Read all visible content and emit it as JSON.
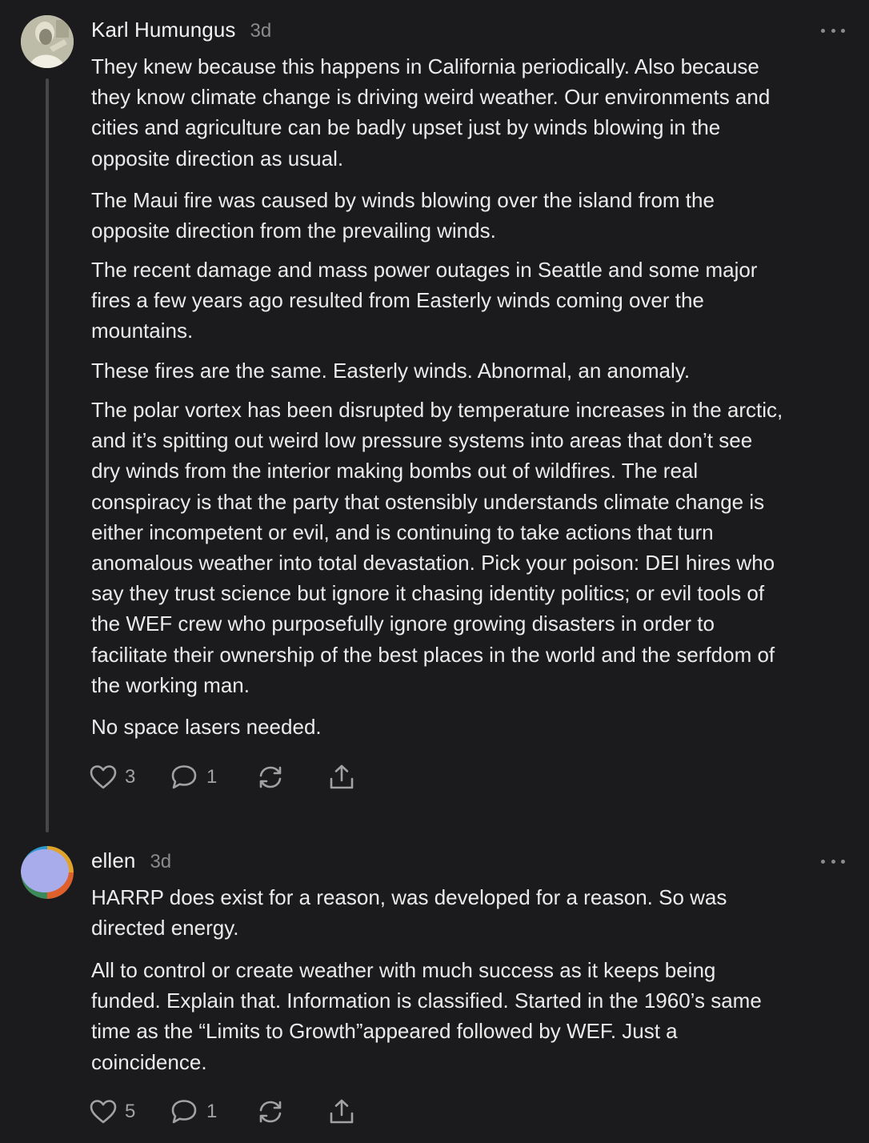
{
  "comments": [
    {
      "author": "Karl Humungus",
      "age": "3d",
      "paragraphs": [
        "They knew because this happens in California periodically. Also because\nthey know climate change is driving weird weather. Our environments and\ncities and agriculture can be badly upset just by winds blowing in the\nopposite direction as usual.",
        "The Maui fire was caused by winds blowing over the island from the\nopposite direction from the prevailing winds.",
        "The recent damage and mass power outages in Seattle and some major\nfires a few years ago resulted from Easterly winds coming over the\nmountains.",
        "These fires are the same. Easterly winds. Abnormal, an anomaly.",
        "The polar vortex has been disrupted by temperature increases in the arctic,\nand it’s spitting out weird low pressure systems into areas that don’t see\ndry winds from the interior making bombs out of wildfires. The real\nconspiracy is that the party that ostensibly understands climate change is\neither incompetent or evil, and is continuing to take actions that turn\nanomalous weather into total devastation. Pick your poison: DEI hires who\nsay they trust science but ignore it chasing identity politics; or evil tools of\nthe WEF crew who purposefully ignore growing disasters in order to\nfacilitate their ownership of the best places in the world and the serfdom of\nthe working man.",
        "No space lasers needed."
      ],
      "likes": "3",
      "replies": "1",
      "icons": [
        "heart-icon",
        "comment-bubble-icon",
        "restack-icon",
        "share-icon",
        "more-options-icon"
      ]
    },
    {
      "author": "ellen",
      "age": "3d",
      "paragraphs": [
        "HARRP does exist for a reason, was developed for a reason. So was\ndirected energy.",
        "All to control or create weather with much success as it keeps being\nfunded. Explain that. Information is classified. Started in the 1960’s same\ntime as the “Limits to Growth”appeared followed by WEF. Just a\ncoincidence."
      ],
      "likes": "5",
      "replies": "1",
      "icons": [
        "heart-icon",
        "comment-bubble-icon",
        "restack-icon",
        "share-icon",
        "more-options-icon"
      ]
    }
  ],
  "colors": {
    "background": "#1b1b1d",
    "text": "#ebebeb",
    "muted": "#8b8b8e",
    "thread_line": "#47474a"
  }
}
